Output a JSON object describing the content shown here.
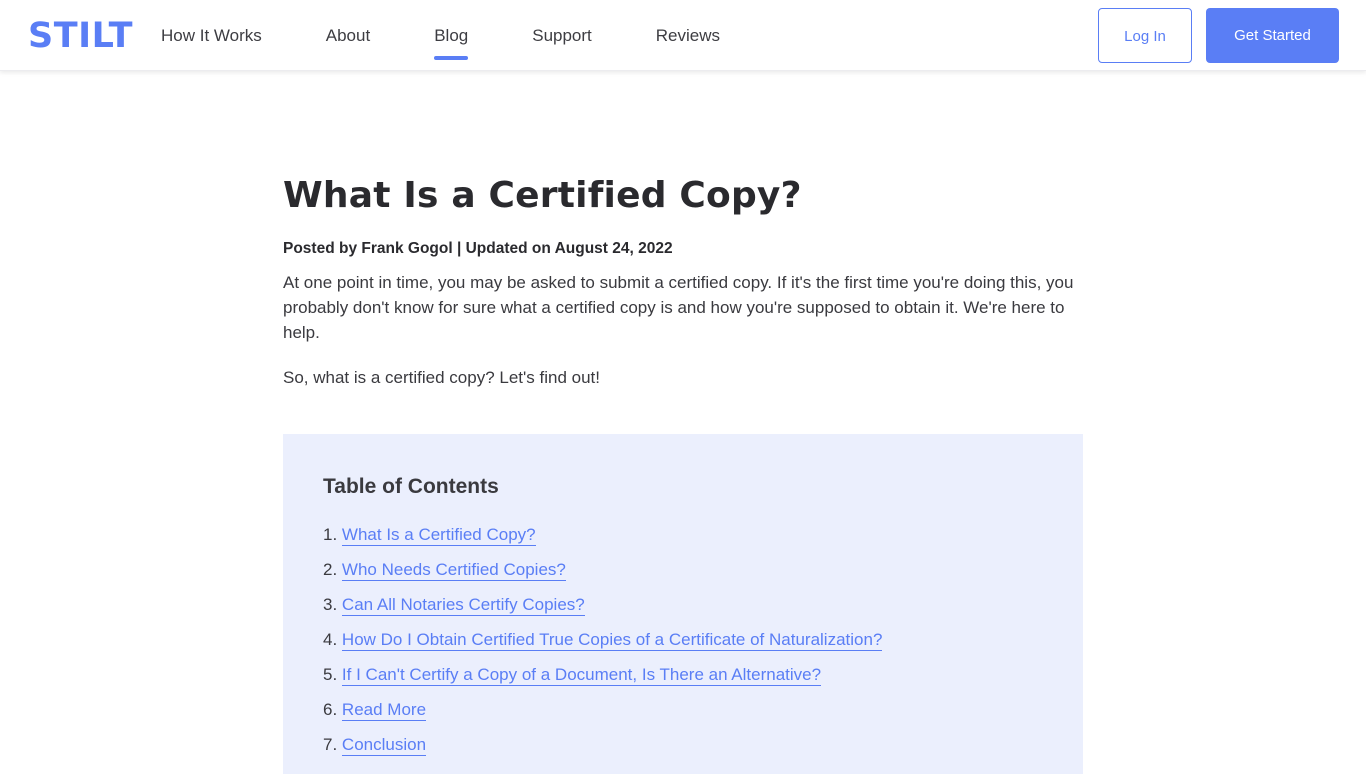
{
  "header": {
    "logo": "STILT",
    "nav": [
      {
        "label": "How It Works",
        "active": false
      },
      {
        "label": "About",
        "active": false
      },
      {
        "label": "Blog",
        "active": true
      },
      {
        "label": "Support",
        "active": false
      },
      {
        "label": "Reviews",
        "active": false
      }
    ],
    "login_label": "Log In",
    "get_started_label": "Get Started"
  },
  "colors": {
    "brand": "#5a7ef5",
    "toc_background": "#ebeffd",
    "text": "#2a2a2e"
  },
  "article": {
    "title": "What Is a Certified Copy?",
    "meta": "Posted by Frank Gogol | Updated on August 24, 2022",
    "paragraphs": [
      "At one point in time, you may be asked to submit a certified copy. If it's the first time you're doing this, you probably don't know for sure what a certified copy is and how you're supposed to obtain it. We're here to help.",
      "So, what is a certified copy? Let's find out!"
    ]
  },
  "toc": {
    "title": "Table of Contents",
    "items": [
      {
        "num": "1.",
        "label": "What Is a Certified Copy?"
      },
      {
        "num": "2.",
        "label": "Who Needs Certified Copies?"
      },
      {
        "num": "3.",
        "label": "Can All Notaries Certify Copies?"
      },
      {
        "num": "4.",
        "label": "How Do I Obtain Certified True Copies of a Certificate of Naturalization?"
      },
      {
        "num": "5.",
        "label": "If I Can't Certify a Copy of a Document, Is There an Alternative?"
      },
      {
        "num": "6.",
        "label": "Read More"
      },
      {
        "num": "7.",
        "label": "Conclusion"
      }
    ]
  }
}
